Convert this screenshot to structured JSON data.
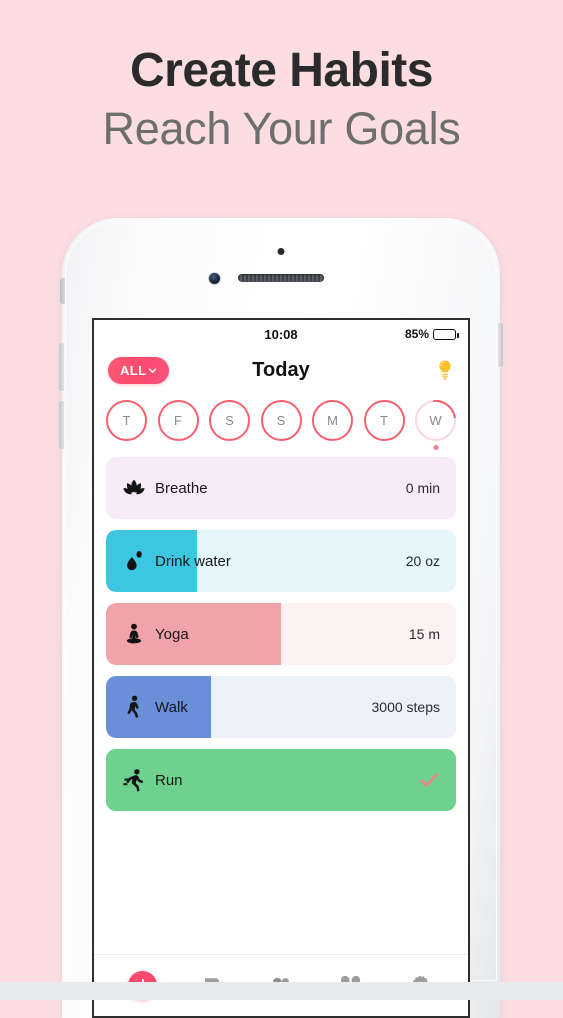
{
  "promo": {
    "title": "Create Habits",
    "subtitle": "Reach Your Goals"
  },
  "colors": {
    "page_background": "#FCDEE2",
    "accent_pink": "#FB4F70",
    "bulb_yellow": "#FBC02D",
    "check_coral": "#F4808E"
  },
  "status_bar": {
    "time": "10:08",
    "battery_percent": "85%",
    "battery_level": 85
  },
  "navbar": {
    "filter_label": "ALL",
    "title": "Today",
    "tip_icon": "lightbulb-icon"
  },
  "day_strip": [
    {
      "label": "T",
      "today": false
    },
    {
      "label": "F",
      "today": false
    },
    {
      "label": "S",
      "today": false
    },
    {
      "label": "S",
      "today": false
    },
    {
      "label": "M",
      "today": false
    },
    {
      "label": "T",
      "today": false
    },
    {
      "label": "W",
      "today": true
    }
  ],
  "habits": [
    {
      "name": "Breathe",
      "value": "0 min",
      "icon": "lotus-icon",
      "progress_percent": 0,
      "fill_color": "#F7EBF7",
      "track_color": "#F7EBF7",
      "completed": false
    },
    {
      "name": "Drink water",
      "value": "20 oz",
      "icon": "water-drop-icon",
      "progress_percent": 26,
      "fill_color": "#3CC6E0",
      "track_color": "#E6F7FB",
      "completed": false
    },
    {
      "name": "Yoga",
      "value": "15 m",
      "icon": "yoga-icon",
      "progress_percent": 50,
      "fill_color": "#F0A3A8",
      "track_color": "#FDF1F2",
      "completed": false
    },
    {
      "name": "Walk",
      "value": "3000 steps",
      "icon": "walking-icon",
      "progress_percent": 30,
      "fill_color": "#6A8FD8",
      "track_color": "#EDF1FA",
      "completed": false
    },
    {
      "name": "Run",
      "value": "",
      "icon": "running-icon",
      "progress_percent": 100,
      "fill_color": "#6FD18E",
      "track_color": "#6FD18E",
      "completed": true
    }
  ],
  "tab_bar": [
    {
      "name": "add-habit",
      "icon": "plus-icon"
    },
    {
      "name": "notes",
      "icon": "note-icon"
    },
    {
      "name": "friends",
      "icon": "people-icon"
    },
    {
      "name": "categories",
      "icon": "clover-icon"
    },
    {
      "name": "settings",
      "icon": "gear-icon"
    }
  ]
}
